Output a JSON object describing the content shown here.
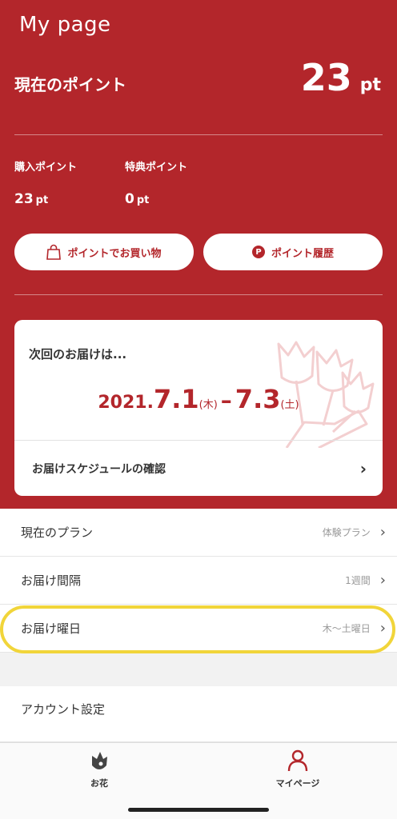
{
  "header": {
    "title": "My page",
    "current_label": "現在のポイント",
    "current_value": "23",
    "current_unit": "pt",
    "purchase_label": "購入ポイント",
    "purchase_value": "23",
    "purchase_unit": "pt",
    "bonus_label": "特典ポイント",
    "bonus_value": "0",
    "bonus_unit": "pt",
    "shop_button": "ポイントでお買い物",
    "history_button": "ポイント履歴",
    "history_icon_letter": "P"
  },
  "delivery": {
    "next_label": "次回のお届けは...",
    "year": "2021.",
    "start_md": "7.1",
    "start_dow": "(木)",
    "dash": "–",
    "end_md": "7.3",
    "end_dow": "(土)",
    "schedule_link": "お届けスケジュールの確認"
  },
  "settings": [
    {
      "label": "現在のプラン",
      "value": "体験プラン"
    },
    {
      "label": "お届け間隔",
      "value": "1週間"
    },
    {
      "label": "お届け曜日",
      "value": "木〜土曜日"
    }
  ],
  "account": {
    "label": "アカウント設定"
  },
  "tabs": {
    "flowers": "お花",
    "mypage": "マイページ"
  },
  "colors": {
    "brand_red": "#b3262b",
    "highlight_yellow": "#f1d53a"
  }
}
